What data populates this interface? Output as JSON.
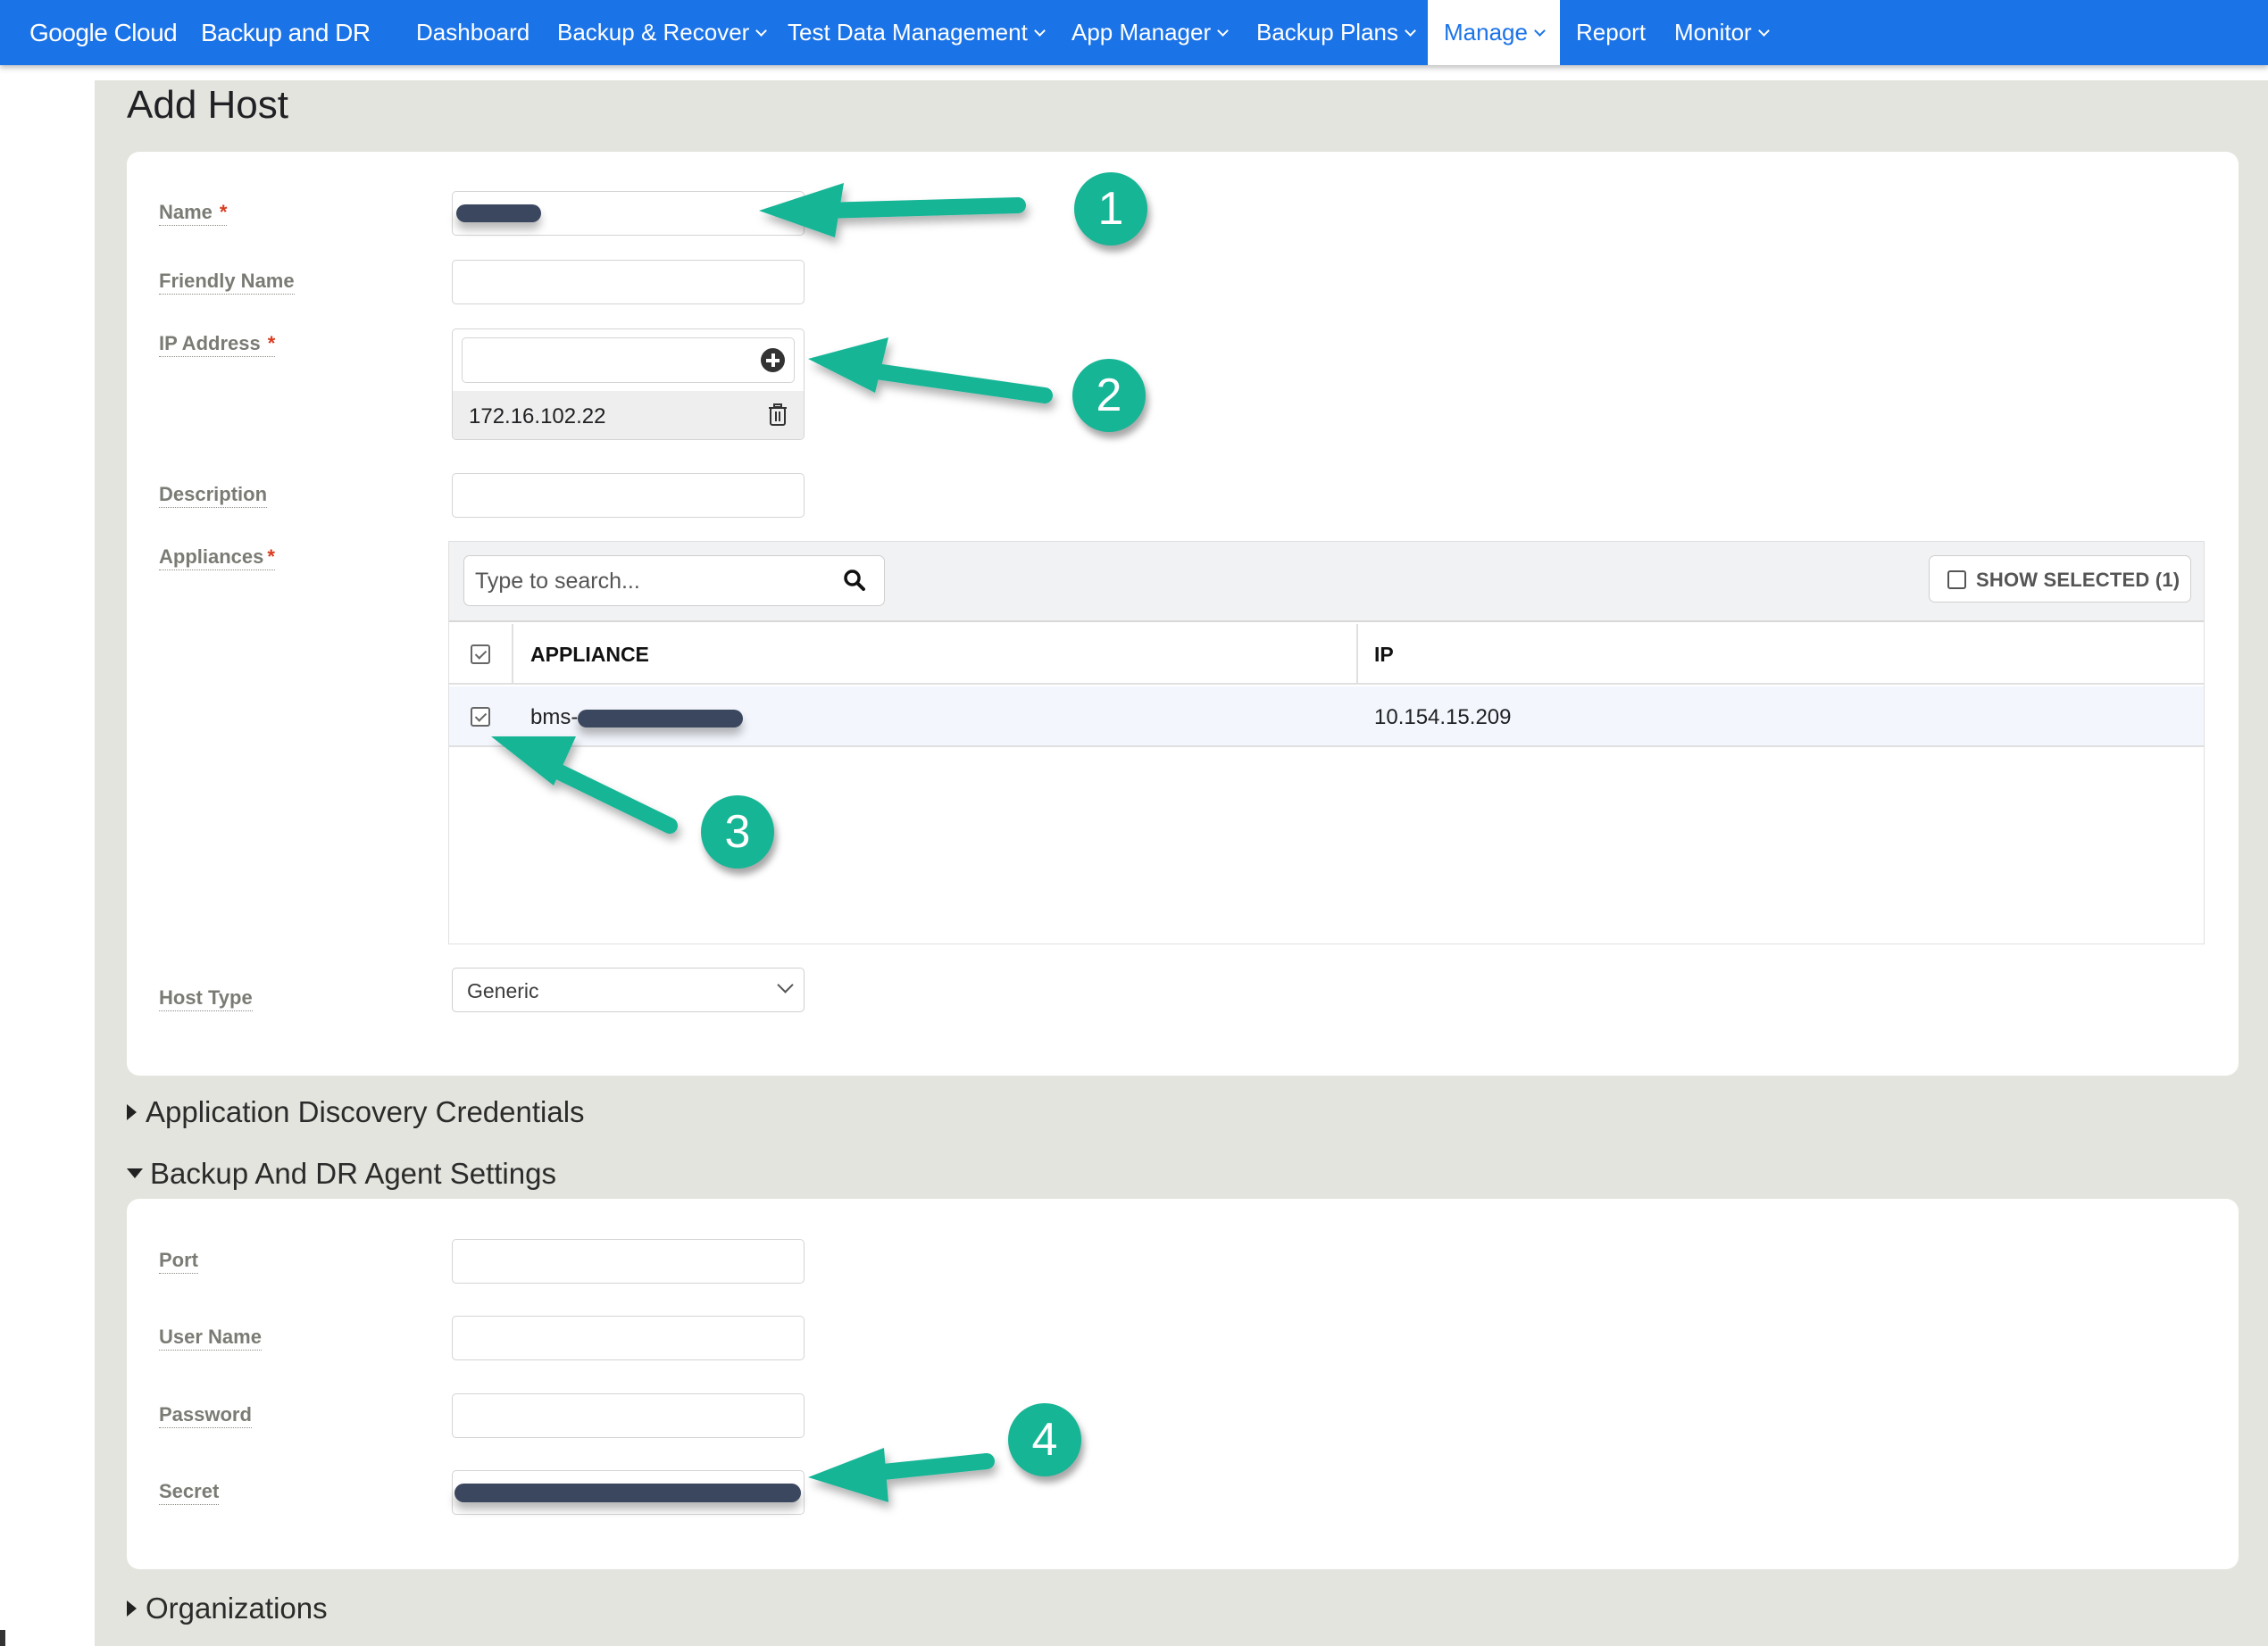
{
  "header": {
    "brand": "Google Cloud",
    "product": "Backup and DR",
    "nav": [
      {
        "label": "Dashboard",
        "has_menu": false,
        "active": false
      },
      {
        "label": "Backup & Recover",
        "has_menu": true,
        "active": false
      },
      {
        "label": "Test Data Management",
        "has_menu": true,
        "active": false
      },
      {
        "label": "App Manager",
        "has_menu": true,
        "active": false
      },
      {
        "label": "Backup Plans",
        "has_menu": true,
        "active": false
      },
      {
        "label": "Manage",
        "has_menu": true,
        "active": true
      },
      {
        "label": "Report",
        "has_menu": false,
        "active": false
      },
      {
        "label": "Monitor",
        "has_menu": true,
        "active": false
      }
    ]
  },
  "page": {
    "title": "Add Host"
  },
  "form": {
    "name": {
      "label": "Name",
      "required": "*",
      "value": "[redacted]"
    },
    "friendly_name": {
      "label": "Friendly Name",
      "value": ""
    },
    "ip_address": {
      "label": "IP Address",
      "required": "*",
      "input_value": "",
      "entries": [
        "172.16.102.22"
      ]
    },
    "description": {
      "label": "Description",
      "value": ""
    },
    "appliances": {
      "label": "Appliances",
      "required": "*",
      "search_placeholder": "Type to search...",
      "show_selected_label": "SHOW SELECTED (1)",
      "columns": [
        "APPLIANCE",
        "IP"
      ],
      "rows": [
        {
          "appliance": "bms-",
          "appliance_redacted": true,
          "ip": "10.154.15.209",
          "checked": true
        }
      ]
    },
    "host_type": {
      "label": "Host Type",
      "value": "Generic"
    }
  },
  "sections": {
    "app_discovery": {
      "label": "Application Discovery Credentials",
      "expanded": false
    },
    "agent_settings": {
      "label": "Backup And DR Agent Settings",
      "expanded": true,
      "fields": {
        "port": {
          "label": "Port",
          "value": ""
        },
        "user_name": {
          "label": "User Name",
          "value": ""
        },
        "password": {
          "label": "Password",
          "value": ""
        },
        "secret": {
          "label": "Secret",
          "value": "[redacted]"
        }
      }
    },
    "organizations": {
      "label": "Organizations",
      "expanded": false
    }
  },
  "annotations": {
    "callouts": [
      "1",
      "2",
      "3",
      "4"
    ],
    "color": "#16b596"
  }
}
